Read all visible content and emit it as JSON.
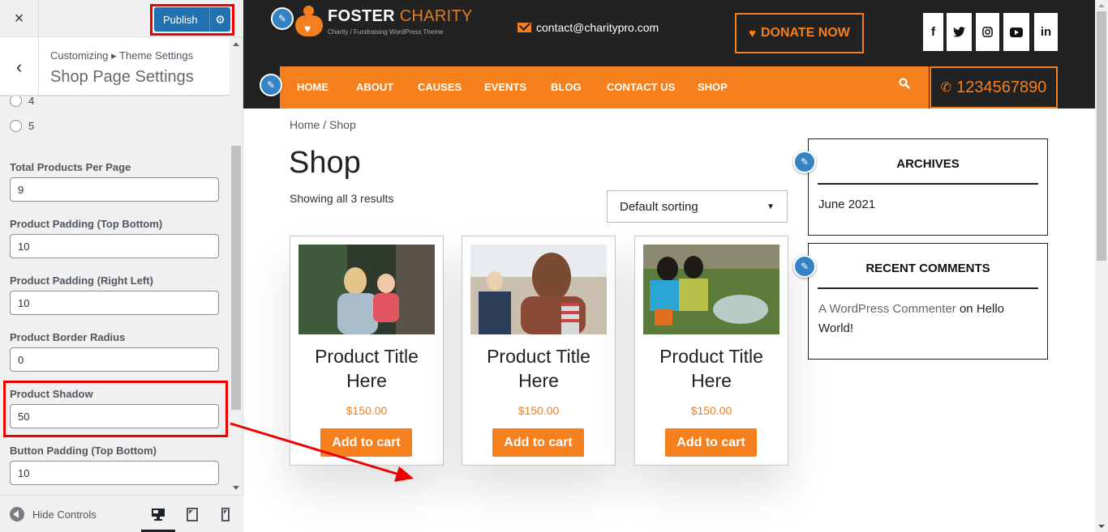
{
  "customizer": {
    "close_label": "×",
    "publish_label": "Publish",
    "breadcrumb": "Customizing ▸ Theme Settings",
    "section_title": "Shop Page Settings",
    "radio_options": [
      {
        "label": "4",
        "checked": false
      },
      {
        "label": "5",
        "checked": false
      }
    ],
    "fields": [
      {
        "label": "Total Products Per Page",
        "value": "9"
      },
      {
        "label": "Product Padding (Top Bottom)",
        "value": "10"
      },
      {
        "label": "Product Padding (Right Left)",
        "value": "10"
      },
      {
        "label": "Product Border Radius",
        "value": "0"
      },
      {
        "label": "Product Shadow",
        "value": "50",
        "highlighted": true
      },
      {
        "label": "Button Padding (Top Bottom)",
        "value": "10"
      }
    ],
    "footer": {
      "hide_controls_label": "Hide Controls",
      "devices": [
        "desktop",
        "tablet",
        "mobile"
      ],
      "active_device": "desktop"
    }
  },
  "site": {
    "logo": {
      "name_primary": "FOSTER",
      "name_secondary": "CHARITY",
      "tagline": "Charity / Fundraising WordPress Theme"
    },
    "email": "contact@charitypro.com",
    "donate_label": "DONATE NOW",
    "social": [
      "f",
      "twitter",
      "instagram",
      "youtube",
      "in"
    ],
    "nav": [
      "HOME",
      "ABOUT",
      "CAUSES",
      "EVENTS",
      "BLOG",
      "CONTACT US",
      "SHOP"
    ],
    "phone": "1234567890",
    "breadcrumb": {
      "home": "Home",
      "sep": " / ",
      "current": "Shop"
    },
    "page_title": "Shop",
    "result_count": "Showing all 3 results",
    "sorting": {
      "selected": "Default sorting"
    },
    "products": [
      {
        "title": "Product Title Here",
        "price": "$150.00",
        "button": "Add to cart"
      },
      {
        "title": "Product Title Here",
        "price": "$150.00",
        "button": "Add to cart"
      },
      {
        "title": "Product Title Here",
        "price": "$150.00",
        "button": "Add to cart"
      }
    ],
    "widgets": {
      "archives": {
        "title": "ARCHIVES",
        "items": [
          "June 2021"
        ]
      },
      "recent_comments": {
        "title": "RECENT COMMENTS",
        "author": "A WordPress Commenter",
        "on": " on ",
        "post": "Hello World!"
      }
    },
    "colors": {
      "accent": "#f7801e",
      "dark": "#222222",
      "publish": "#2271b1",
      "highlight": "#ee0000"
    }
  }
}
